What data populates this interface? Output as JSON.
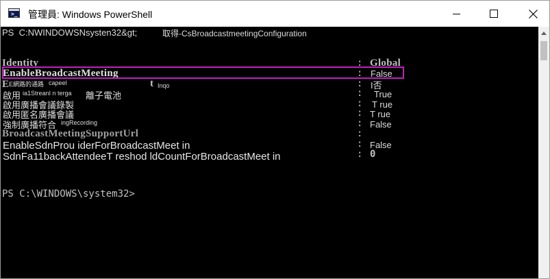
{
  "window": {
    "title": "管理員: Windows PowerShell",
    "icon_text": ">_",
    "controls": {
      "minimize_icon": "minimize-icon",
      "maximize_icon": "maximize-icon",
      "close_icon": "close-icon"
    }
  },
  "console": {
    "prompt_line": "PS  C:NWINDOWSNsysten32&gt;",
    "command": "取得-CsBroadcastmeetingConfiguration",
    "properties": [
      {
        "name": "Identity",
        "value": "Global"
      },
      {
        "name": "EnableBroadcastMeeting",
        "value": "False"
      },
      {
        "name_a": "E網路的通路",
        "name_b": "capeel",
        "name_c": "t",
        "name_d": "Inqo",
        "value": "I否"
      },
      {
        "name_a": "啟用",
        "name_b": "ia1StreanI n terga",
        "name_c": "離子電池",
        "value": "True"
      },
      {
        "name": "啟用廣播會議錄製",
        "value": "T rue"
      },
      {
        "name": "啟用匿名廣播會議",
        "value": "T rue"
      },
      {
        "name_a": "強制廣播符合",
        "name_b": "ingRecording",
        "value": "False"
      },
      {
        "name": "BroadcastMeetingSupportUrl",
        "value": ""
      },
      {
        "name": "EnableSdnProu iderForBroadcastMeet in",
        "value": "False"
      },
      {
        "name": "SdnFa11backAttendeeT reshod ldCountForBroadcastMeet in",
        "value": "0"
      }
    ],
    "final_prompt": "PS C:\\WINDOWS\\system32>"
  }
}
